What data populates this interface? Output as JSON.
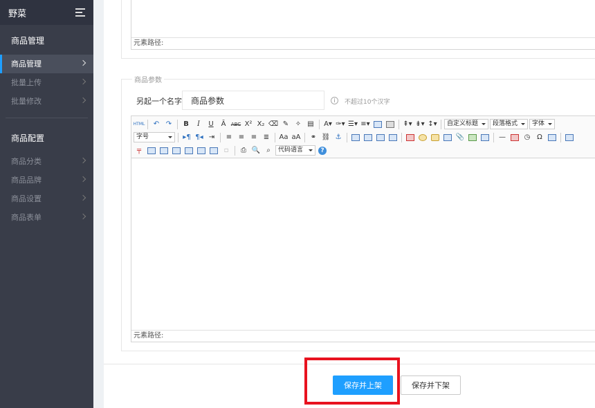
{
  "sidebar": {
    "title": "野菜",
    "groups": [
      {
        "label": "商品管理",
        "items": [
          {
            "label": "商品管理",
            "active": true
          },
          {
            "label": "批量上传"
          },
          {
            "label": "批量修改"
          }
        ]
      },
      {
        "label": "商品配置",
        "items": [
          {
            "label": "商品分类"
          },
          {
            "label": "商品品牌"
          },
          {
            "label": "商品设置"
          },
          {
            "label": "商品表单"
          }
        ]
      }
    ]
  },
  "top_editor": {
    "path_label": "元素路径:"
  },
  "params_section": {
    "title": "商品参数",
    "name_label": "另起一个名字:",
    "name_value": "商品参数",
    "hint": "不超过10个汉字",
    "editor": {
      "toolbar": {
        "row1_dropdowns": [
          "自定义标题",
          "段落格式",
          "字体"
        ],
        "row2_dropdown": "字号",
        "row3_dropdown": "代码语言"
      },
      "path_label": "元素路径:"
    }
  },
  "actions": {
    "publish_label": "保存并上架",
    "unpublish_label": "保存并下架"
  },
  "colors": {
    "primary": "#1e9fff",
    "sidebar": "#393d49",
    "highlight": "#e8121f"
  }
}
